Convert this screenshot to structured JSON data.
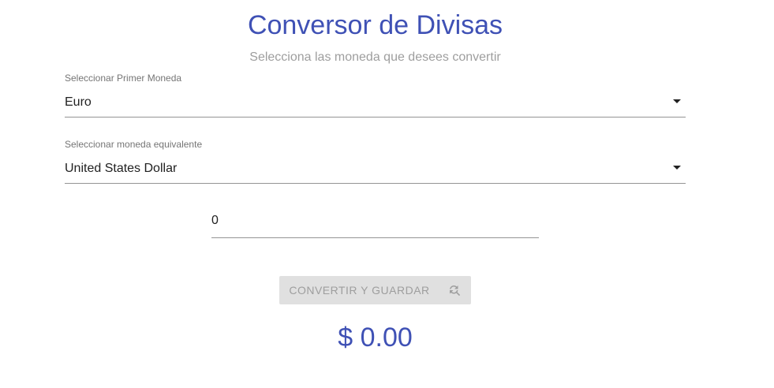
{
  "header": {
    "title": "Conversor de Divisas",
    "subtitle": "Selecciona las moneda que desees convertir"
  },
  "form": {
    "first_currency": {
      "label": "Seleccionar Primer Moneda",
      "value": "Euro"
    },
    "second_currency": {
      "label": "Seleccionar moneda equivalente",
      "value": "United States Dollar"
    },
    "amount": {
      "value": "0"
    },
    "submit": {
      "label": "CONVERTIR Y GUARDAR",
      "icon": "find-replace-icon",
      "disabled": true
    }
  },
  "result": {
    "value": "$ 0.00"
  },
  "colors": {
    "primary": "#3f51b5",
    "muted_text": "#9e9e9e",
    "button_disabled_bg": "#e0e0e0"
  }
}
